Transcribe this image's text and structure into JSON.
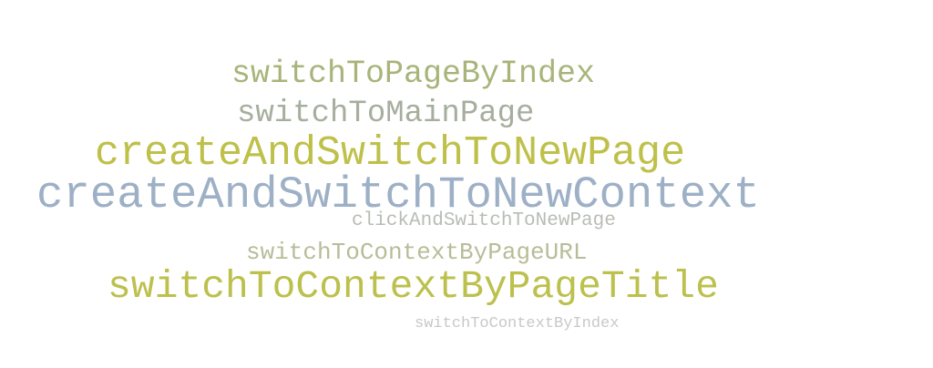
{
  "word_cloud": {
    "words": [
      {
        "text": "switchToPageByIndex",
        "color": "#a8b47a"
      },
      {
        "text": "switchToMainPage",
        "color": "#a6ae9e"
      },
      {
        "text": "createAndSwitchToNewPage",
        "color": "#bec04a"
      },
      {
        "text": "createAndSwitchToNewContext",
        "color": "#9db0c6"
      },
      {
        "text": "clickAndSwitchToNewPage",
        "color": "#b8bdb4"
      },
      {
        "text": "switchToContextByPageURL",
        "color": "#b9bc98"
      },
      {
        "text": "switchToContextByPageTitle",
        "color": "#bcc04c"
      },
      {
        "text": "switchToContextByIndex",
        "color": "#c8c8c8"
      }
    ]
  }
}
